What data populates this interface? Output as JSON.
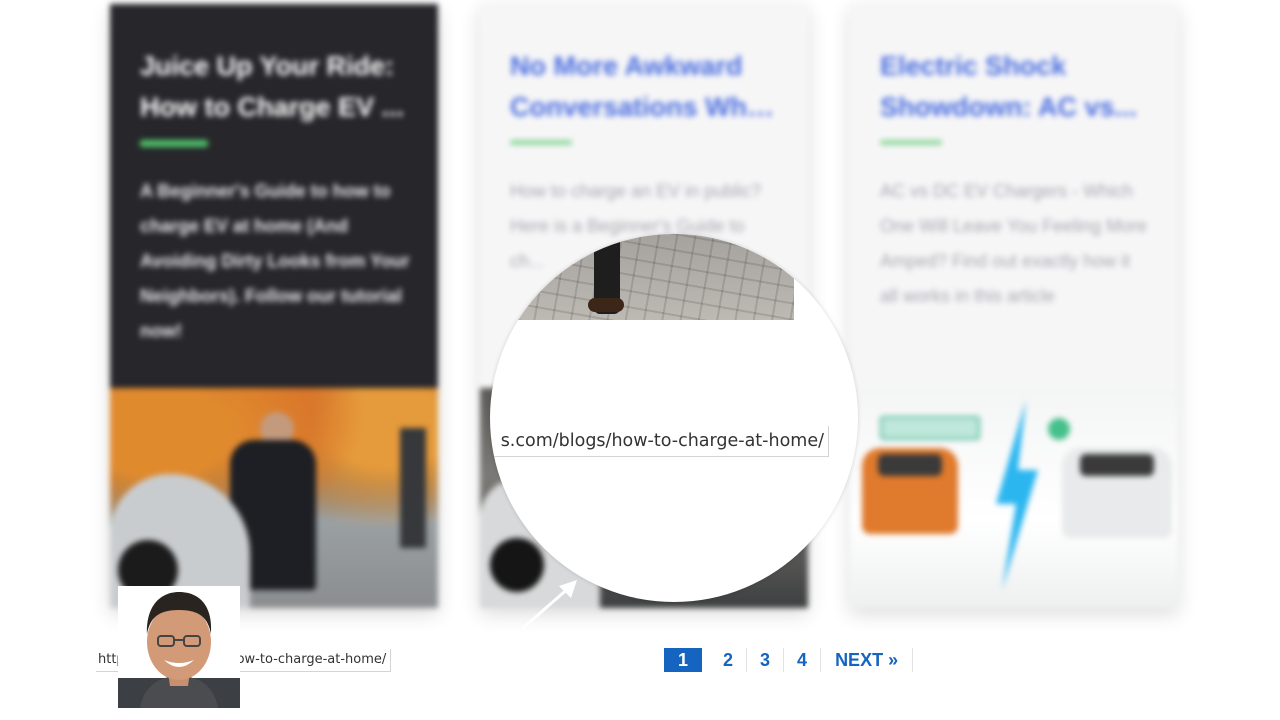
{
  "cards": [
    {
      "title_lines": [
        "Juice Up Your Ride:",
        "How to Charge EV ..."
      ],
      "excerpt": "A Beginner's Guide to how to charge EV at home (And Avoiding Dirty Looks from Your Neighbors). Follow our tutorial now!"
    },
    {
      "title_lines": [
        "No More Awkward",
        "Conversations Whil..."
      ],
      "excerpt": "How to charge an EV in public? Here is a Beginner's Guide to ch..."
    },
    {
      "title_lines": [
        "Electric Shock",
        "Showdown: AC vs..."
      ],
      "excerpt": "AC vs DC EV Chargers - Which One Will Leave You Feeling More Amped? Find out exactly how it all works in this article"
    }
  ],
  "magnifier": {
    "url_fragment": "s.com/blogs/how-to-charge-at-home/"
  },
  "status_bar": {
    "url": "https://...com/blogs/how-to-charge-at-home/"
  },
  "pagination": {
    "pages": [
      "1",
      "2",
      "3",
      "4"
    ],
    "current": "1",
    "next_label": "NEXT »"
  },
  "colors": {
    "link_blue": "#1565c0",
    "title_blue": "#4a6de0",
    "accent_green": "#51c36a",
    "dark_card": "#26262b"
  },
  "icons": {
    "magnifier_arrow": "arrow-up-right-icon",
    "bolt": "lightning-bolt-icon"
  }
}
